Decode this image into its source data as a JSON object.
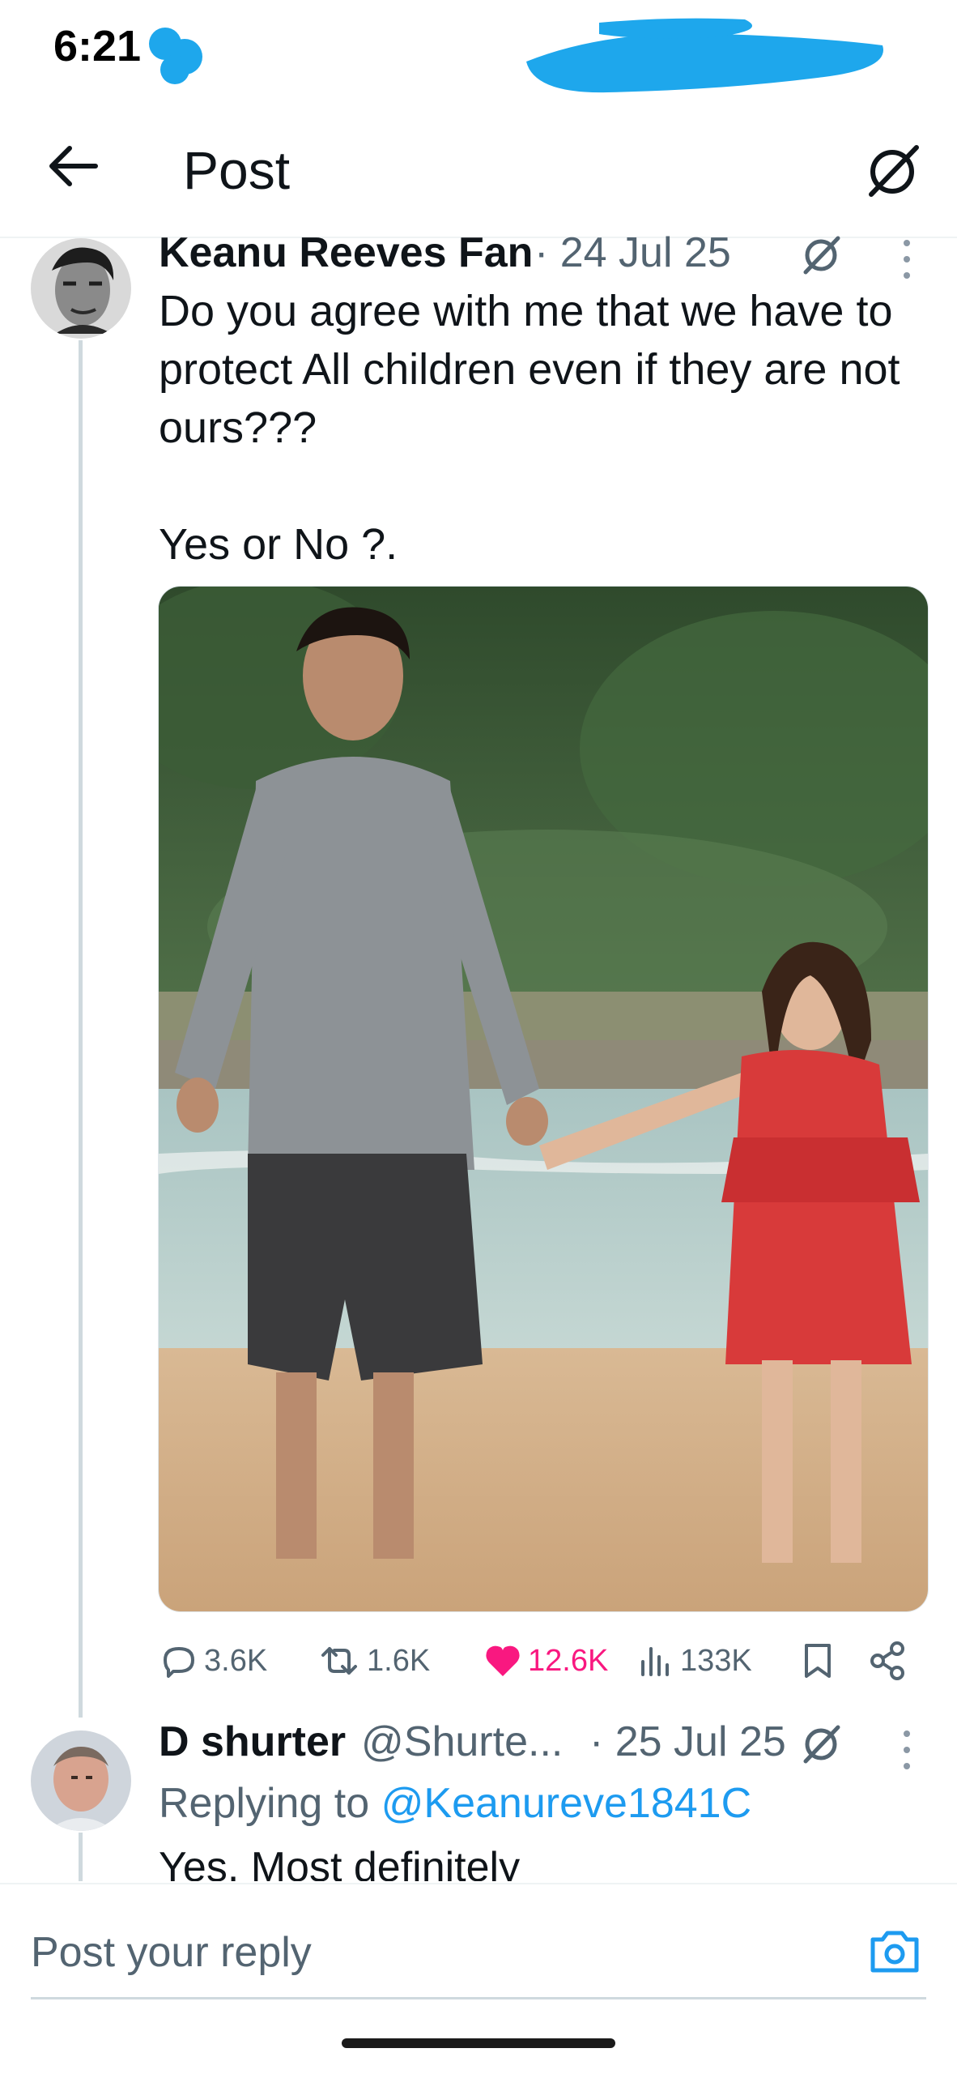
{
  "status_bar": {
    "time": "6:21"
  },
  "header": {
    "title": "Post",
    "back_icon": "arrow-left-icon",
    "grok_icon": "grok-icon"
  },
  "post": {
    "author": "Keanu Reeves Fan",
    "date": "· 24 Jul 25",
    "text": "Do you agree with me that we have to\nprotect All children even if they are not\nours???\n\nYes or No ?.",
    "actions": {
      "replies": "3.6K",
      "reposts": "1.6K",
      "likes": "12.6K",
      "views": "133K"
    }
  },
  "reply": {
    "author": "D shurter",
    "handle": "@Shurte...",
    "date": "· 25 Jul 25",
    "replying_prefix": "Replying to",
    "replying_to": "@Keanureve1841C",
    "text": "Yes. Most definitely"
  },
  "compose": {
    "placeholder": "Post your reply"
  },
  "colors": {
    "accent": "#1d9bf0",
    "like": "#f91880",
    "secondary_text": "#536471",
    "primary_text": "#0f1419",
    "scribble": "#1ea7ec"
  }
}
